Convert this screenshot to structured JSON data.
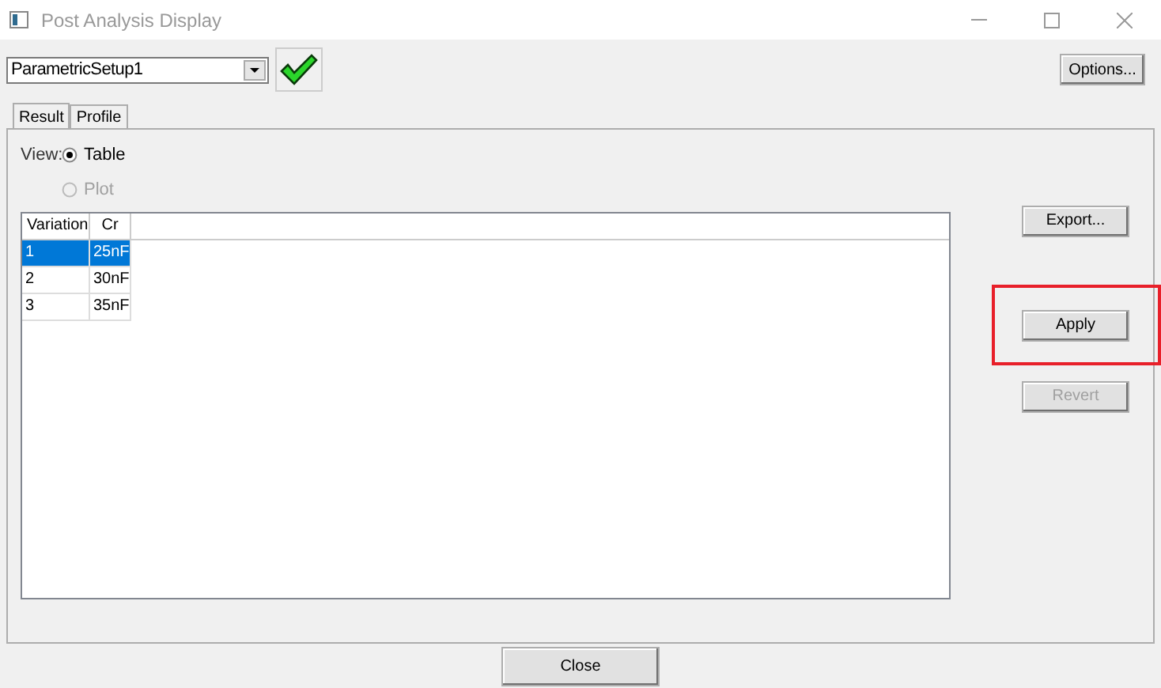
{
  "window": {
    "title": "Post Analysis Display"
  },
  "setup": {
    "value": "ParametricSetup1"
  },
  "options_button": "Options...",
  "tabs": [
    {
      "label": "Result",
      "selected": true
    },
    {
      "label": "Profile",
      "selected": false
    }
  ],
  "view": {
    "label": "View:",
    "options": [
      {
        "label": "Table",
        "selected": true,
        "disabled": false
      },
      {
        "label": "Plot",
        "selected": false,
        "disabled": true
      }
    ]
  },
  "table": {
    "columns": [
      "Variation",
      "Cr"
    ],
    "rows": [
      {
        "cells": [
          "1",
          "25nF"
        ],
        "selected": true
      },
      {
        "cells": [
          "2",
          "30nF"
        ],
        "selected": false
      },
      {
        "cells": [
          "3",
          "35nF"
        ],
        "selected": false
      }
    ]
  },
  "side_buttons": [
    {
      "label": "Export...",
      "disabled": false,
      "highlighted": false
    },
    {
      "label": "Apply",
      "disabled": false,
      "highlighted": true
    },
    {
      "label": "Revert",
      "disabled": true,
      "highlighted": false
    }
  ],
  "close_button": "Close"
}
